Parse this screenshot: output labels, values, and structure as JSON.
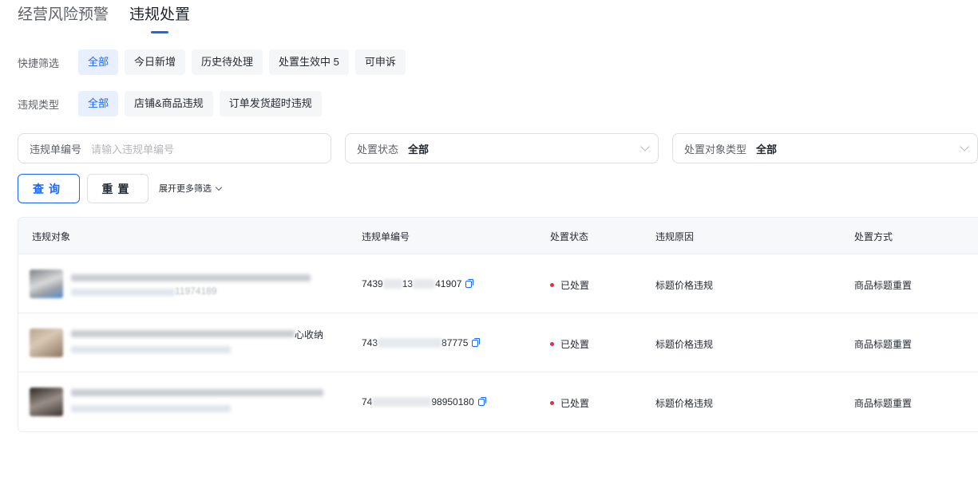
{
  "tabs": [
    {
      "label": "经营风险预警",
      "active": false
    },
    {
      "label": "违规处置",
      "active": true
    }
  ],
  "quick_filter": {
    "label": "快捷筛选",
    "chips": [
      "全部",
      "今日新增",
      "历史待处理",
      "处置生效中 5",
      "可申诉"
    ],
    "selected": "全部"
  },
  "violation_type": {
    "label": "违规类型",
    "chips": [
      "全部",
      "店铺&商品违规",
      "订单发货超时违规"
    ],
    "selected": "全部"
  },
  "search": {
    "order_no_label": "违规单编号",
    "order_no_placeholder": "请输入违规单编号",
    "status_label": "处置状态",
    "status_value": "全部",
    "object_type_label": "处置对象类型",
    "object_type_value": "全部"
  },
  "actions": {
    "query": "查询",
    "reset": "重置",
    "more_filters": "展开更多筛选"
  },
  "table": {
    "columns": [
      "违规对象",
      "违规单编号",
      "处置状态",
      "违规原因",
      "处置方式"
    ],
    "rows": [
      {
        "object_tail": "",
        "object_sub_tail": "11974189",
        "order_head": "7439",
        "order_mid": "13",
        "order_tail": "41907",
        "status": "已处置",
        "reason": "标题价格违规",
        "method": "商品标题重置"
      },
      {
        "object_tail": "心收纳",
        "object_sub_tail": "",
        "order_head": "743",
        "order_mid": "",
        "order_tail": "87775",
        "status": "已处置",
        "reason": "标题价格违规",
        "method": "商品标题重置"
      },
      {
        "object_tail": "",
        "object_sub_tail": "",
        "order_head": "74",
        "order_mid": "",
        "order_tail": "98950180",
        "status": "已处置",
        "reason": "标题价格违规",
        "method": "商品标题重置"
      }
    ]
  },
  "colors": {
    "accent": "#1966ff",
    "status_dot": "#f0283c"
  }
}
